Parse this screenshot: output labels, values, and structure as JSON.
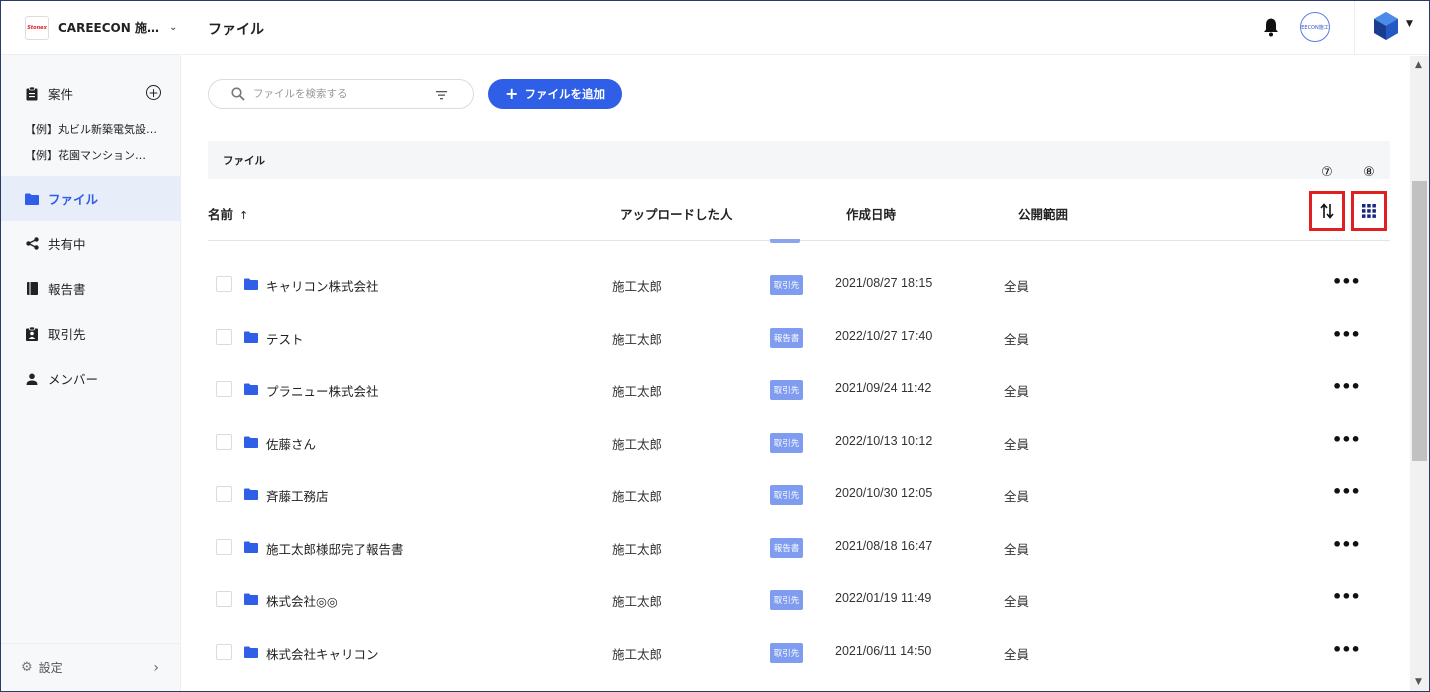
{
  "brand": {
    "logo_text": "Stonex",
    "name": "CAREECON 施…"
  },
  "sidebar": {
    "projects_label": "案件",
    "project_links": [
      "【例】丸ビル新築電気設…",
      "【例】花園マンション…"
    ],
    "items": [
      {
        "label": "ファイル",
        "icon": "folder-icon"
      },
      {
        "label": "共有中",
        "icon": "share-icon"
      },
      {
        "label": "報告書",
        "icon": "book-icon"
      },
      {
        "label": "取引先",
        "icon": "contact-icon"
      },
      {
        "label": "メンバー",
        "icon": "person-icon"
      }
    ],
    "settings_label": "設定"
  },
  "header": {
    "title": "ファイル",
    "org_avatar_text": "EECON施工"
  },
  "toolbar": {
    "search_placeholder": "ファイルを検索する",
    "add_button_label": "ファイルを追加"
  },
  "breadcrumb": "ファイル",
  "table": {
    "columns": {
      "name": "名前",
      "sort_arrow": "↑",
      "uploader": "アップロードした人",
      "created": "作成日時",
      "scope": "公開範囲"
    },
    "markers": {
      "sort": "⑦",
      "view": "⑧"
    },
    "rows": [
      {
        "name": "キャリコン株式会社",
        "uploader": "施工太郎",
        "tag": "取引先",
        "created": "2021/08/27 18:15",
        "scope": "全員"
      },
      {
        "name": "テスト",
        "uploader": "施工太郎",
        "tag": "報告書",
        "created": "2022/10/27 17:40",
        "scope": "全員"
      },
      {
        "name": "プラニュー株式会社",
        "uploader": "施工太郎",
        "tag": "取引先",
        "created": "2021/09/24 11:42",
        "scope": "全員"
      },
      {
        "name": "佐藤さん",
        "uploader": "施工太郎",
        "tag": "取引先",
        "created": "2022/10/13 10:12",
        "scope": "全員"
      },
      {
        "name": "斉藤工務店",
        "uploader": "施工太郎",
        "tag": "取引先",
        "created": "2020/10/30 12:05",
        "scope": "全員"
      },
      {
        "name": "施工太郎様邸完了報告書",
        "uploader": "施工太郎",
        "tag": "報告書",
        "created": "2021/08/18 16:47",
        "scope": "全員"
      },
      {
        "name": "株式会社◎◎",
        "uploader": "施工太郎",
        "tag": "取引先",
        "created": "2022/01/19 11:49",
        "scope": "全員"
      },
      {
        "name": "株式会社キャリコン",
        "uploader": "施工太郎",
        "tag": "取引先",
        "created": "2021/06/11 14:50",
        "scope": "全員"
      }
    ]
  },
  "colors": {
    "accent": "#2f5fe6",
    "tag": "#7f9cf0",
    "highlight": "#e02020"
  }
}
